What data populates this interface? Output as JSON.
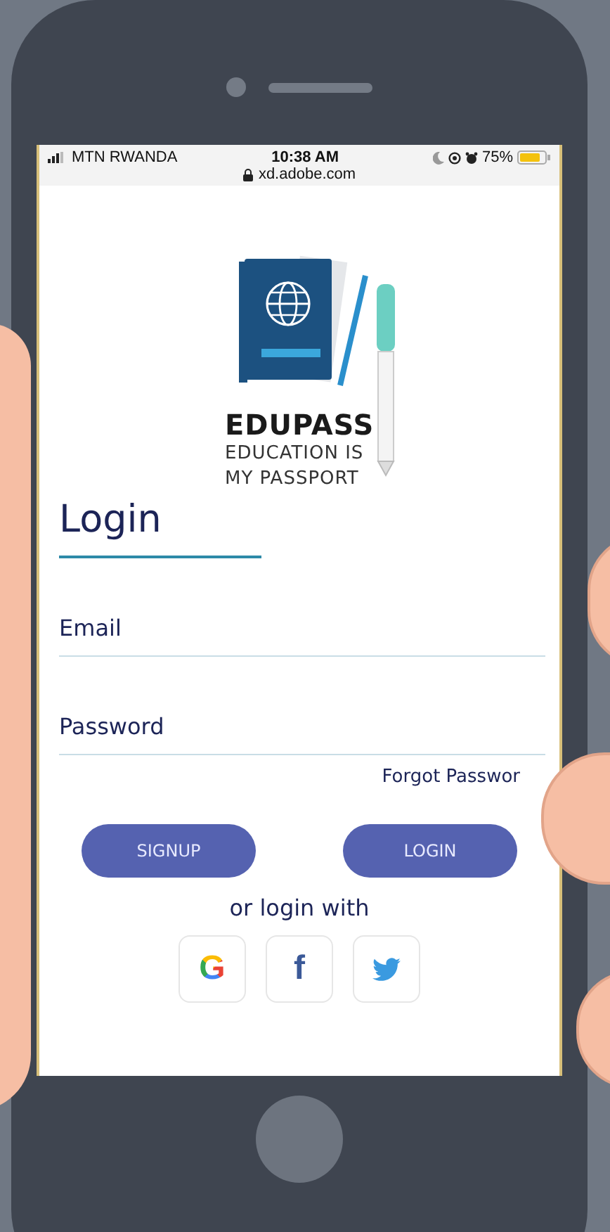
{
  "status_bar": {
    "carrier": "MTN RWANDA",
    "time": "10:38 AM",
    "url": "xd.adobe.com",
    "battery": "75%"
  },
  "logo": {
    "name": "EDUPASS",
    "tagline": [
      "EDUCATION IS",
      "MY PASSPORT"
    ]
  },
  "title": "Login",
  "fields": [
    {
      "placeholder": "Email"
    },
    {
      "placeholder": "Password"
    }
  ],
  "forgot_link": "Forgot Passwor",
  "buttons": [
    "SIGNUP",
    "LOGIN"
  ],
  "alt_login": "or login with",
  "social": [
    {
      "kind": "google",
      "glyph": "G"
    },
    {
      "kind": "facebook",
      "glyph": "f"
    },
    {
      "kind": "twitter"
    }
  ]
}
